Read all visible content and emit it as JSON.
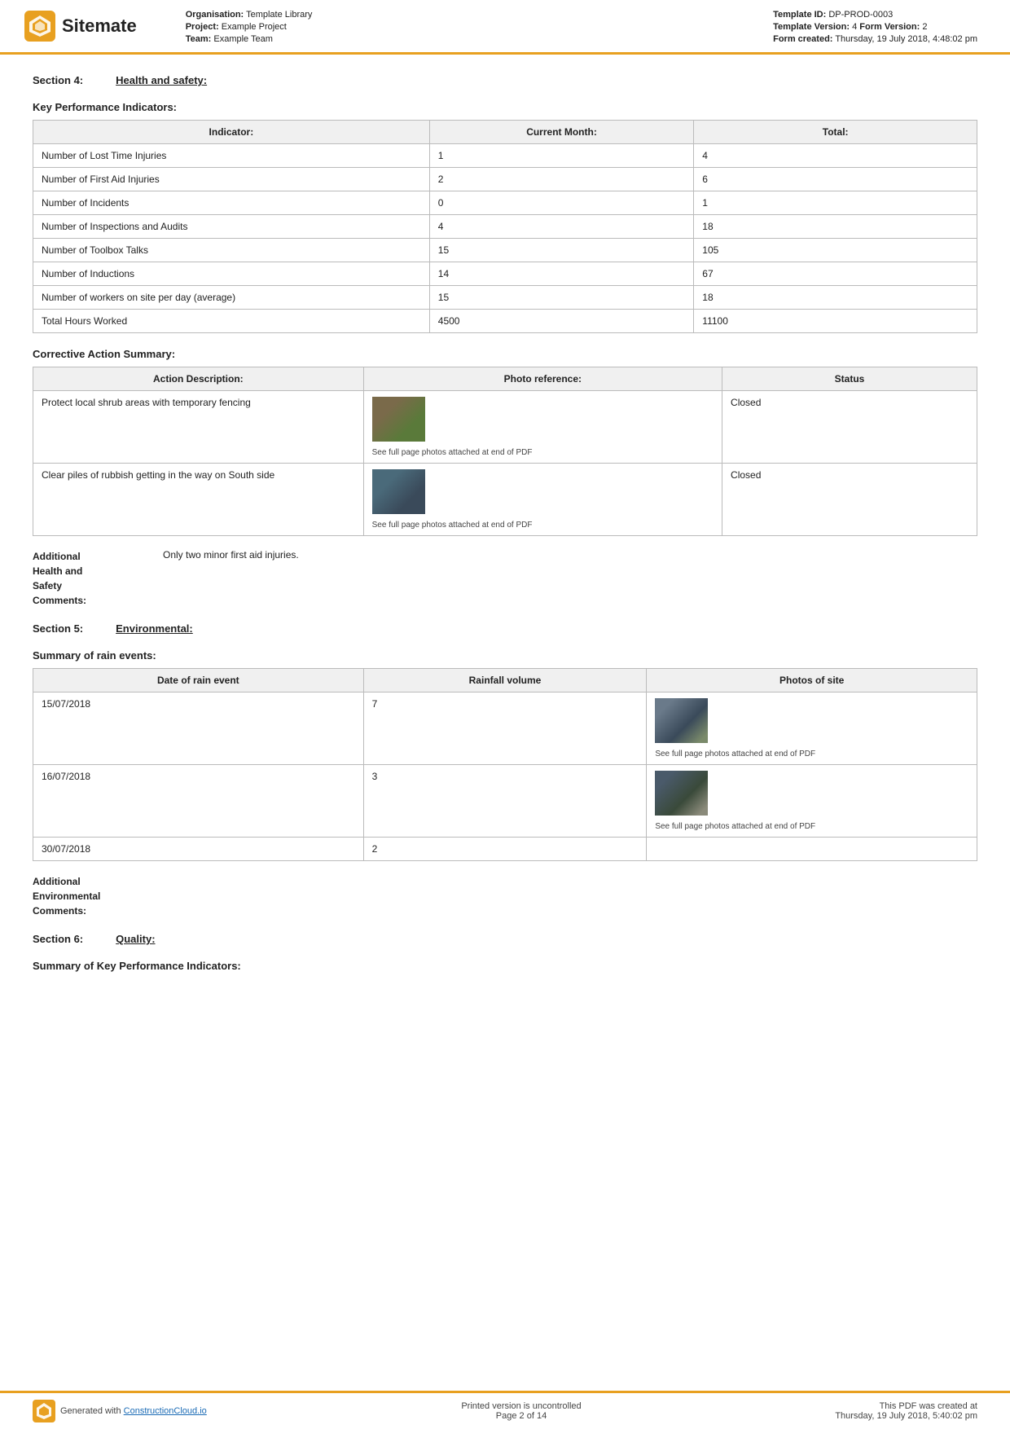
{
  "header": {
    "logo_text": "Sitemate",
    "org_label": "Organisation:",
    "org_value": "Template Library",
    "project_label": "Project:",
    "project_value": "Example Project",
    "team_label": "Team:",
    "team_value": "Example Team",
    "template_id_label": "Template ID:",
    "template_id_value": "DP-PROD-0003",
    "template_version_label": "Template Version:",
    "template_version_value": "4",
    "form_version_label": "Form Version:",
    "form_version_value": "2",
    "form_created_label": "Form created:",
    "form_created_value": "Thursday, 19 July 2018, 4:48:02 pm"
  },
  "section4": {
    "label": "Section 4:",
    "title": "Health and safety:"
  },
  "kpi": {
    "heading": "Key Performance Indicators:",
    "col_indicator": "Indicator:",
    "col_current": "Current Month:",
    "col_total": "Total:",
    "rows": [
      {
        "indicator": "Number of Lost Time Injuries",
        "current": "1",
        "total": "4"
      },
      {
        "indicator": "Number of First Aid Injuries",
        "current": "2",
        "total": "6"
      },
      {
        "indicator": "Number of Incidents",
        "current": "0",
        "total": "1"
      },
      {
        "indicator": "Number of Inspections and Audits",
        "current": "4",
        "total": "18"
      },
      {
        "indicator": "Number of Toolbox Talks",
        "current": "15",
        "total": "105"
      },
      {
        "indicator": "Number of Inductions",
        "current": "14",
        "total": "67"
      },
      {
        "indicator": "Number of workers on site per day (average)",
        "current": "15",
        "total": "18"
      },
      {
        "indicator": "Total Hours Worked",
        "current": "4500",
        "total": "11100"
      }
    ]
  },
  "corrective": {
    "heading": "Corrective Action Summary:",
    "col_action": "Action Description:",
    "col_photo": "Photo reference:",
    "col_status": "Status",
    "rows": [
      {
        "action": "Protect local shrub areas with temporary fencing",
        "photo_caption": "See full page photos attached at end of PDF",
        "status": "Closed",
        "thumb_class": "thumb-shrub"
      },
      {
        "action": "Clear piles of rubbish getting in the way on South side",
        "photo_caption": "See full page photos attached at end of PDF",
        "status": "Closed",
        "thumb_class": "thumb-rubbish"
      }
    ]
  },
  "health_comments": {
    "label": "Additional\nHealth and\nSafety\nComments:",
    "value": "Only two minor first aid injuries."
  },
  "section5": {
    "label": "Section 5:",
    "title": "Environmental:"
  },
  "rain": {
    "heading": "Summary of rain events:",
    "col_date": "Date of rain event",
    "col_rainfall": "Rainfall volume",
    "col_photos": "Photos of site",
    "rows": [
      {
        "date": "15/07/2018",
        "rainfall": "7",
        "photo_caption": "See full page photos attached at end of PDF",
        "has_photo": true,
        "thumb_class": "thumb-rain1"
      },
      {
        "date": "16/07/2018",
        "rainfall": "3",
        "photo_caption": "See full page photos attached at end of PDF",
        "has_photo": true,
        "thumb_class": "thumb-rain2"
      },
      {
        "date": "30/07/2018",
        "rainfall": "2",
        "photo_caption": "",
        "has_photo": false,
        "thumb_class": ""
      }
    ]
  },
  "env_comments": {
    "label": "Additional\nEnvironmental\nComments:"
  },
  "section6": {
    "label": "Section 6:",
    "title": "Quality:"
  },
  "quality_kpi": {
    "heading": "Summary of Key Performance Indicators:"
  },
  "footer": {
    "generated_text": "Generated with ",
    "link_text": "ConstructionCloud.io",
    "center_line1": "Printed version is uncontrolled",
    "center_line2": "Page 2 of 14",
    "right_line1": "This PDF was created at",
    "right_line2": "Thursday, 19 July 2018, 5:40:02 pm"
  }
}
